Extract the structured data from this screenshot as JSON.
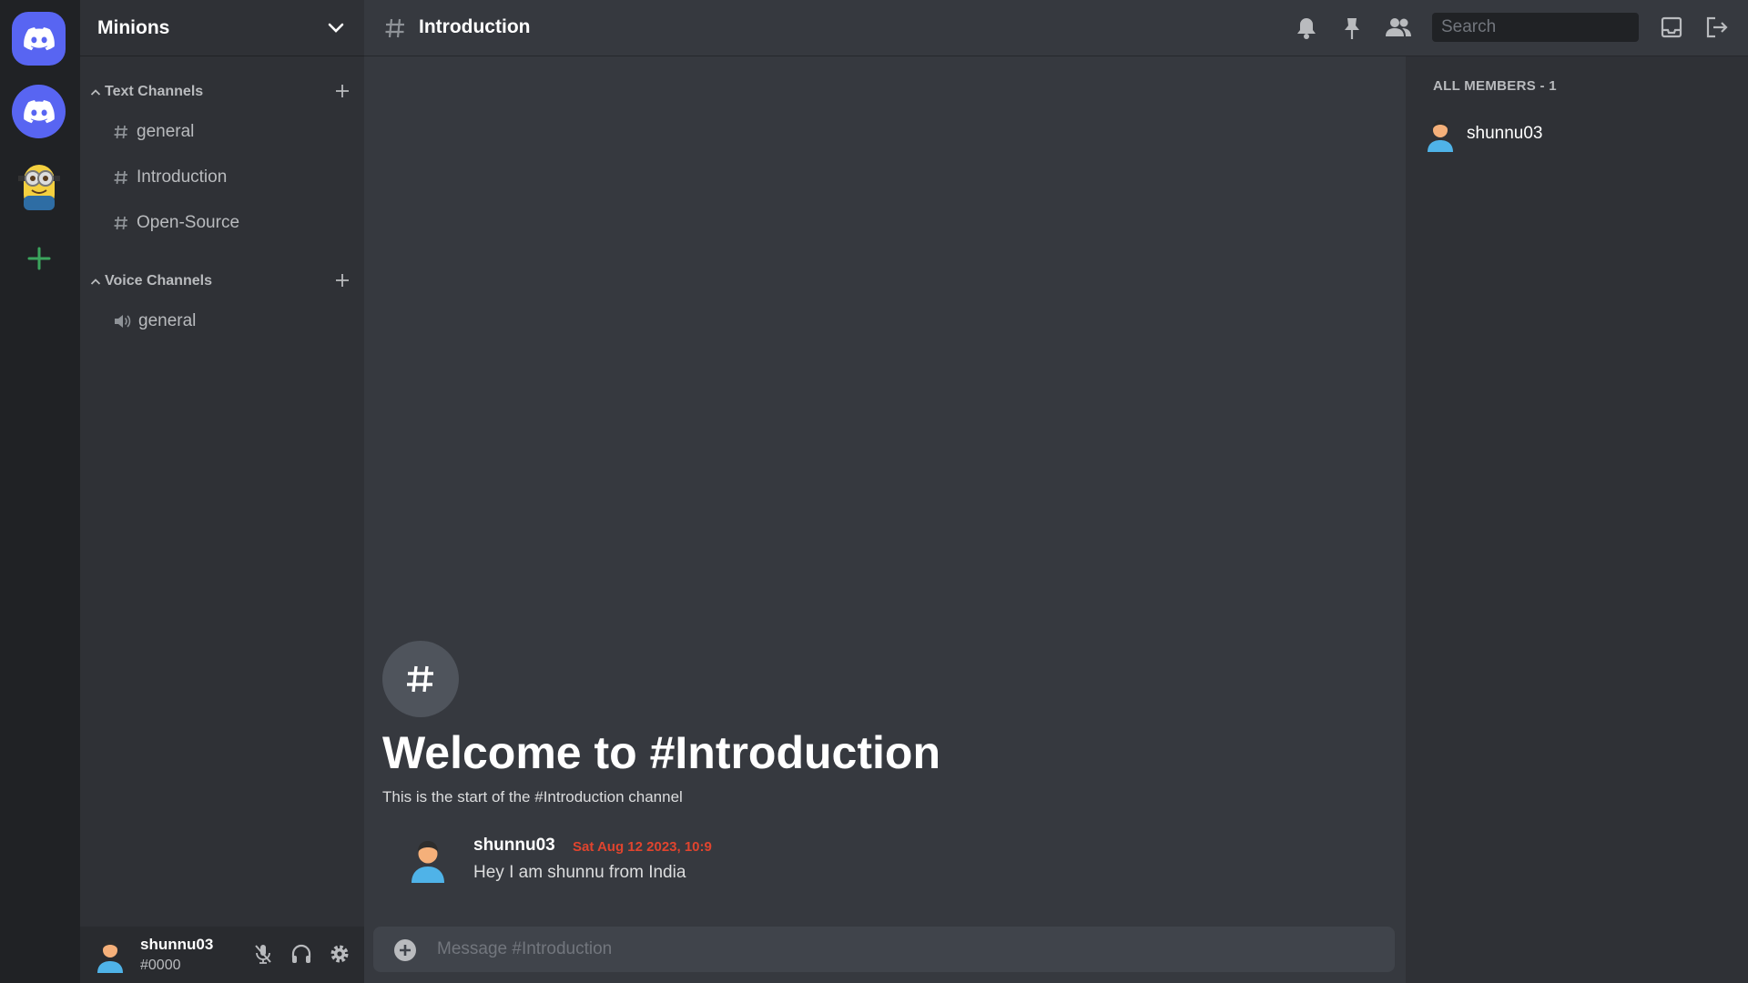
{
  "servers": [
    {
      "name": "Discord Home",
      "icon": "discord-logo-icon"
    },
    {
      "name": "Discord",
      "icon": "discord-logo-icon"
    },
    {
      "name": "Minions",
      "icon": "minion-avatar-icon"
    }
  ],
  "add_server_icon": "plus-icon",
  "server": {
    "name": "Minions"
  },
  "categories": {
    "text": {
      "label": "Text Channels",
      "channels": [
        {
          "name": "general"
        },
        {
          "name": "Introduction"
        },
        {
          "name": "Open-Source"
        }
      ]
    },
    "voice": {
      "label": "Voice Channels",
      "channels": [
        {
          "name": "general"
        }
      ]
    }
  },
  "user": {
    "name": "shunnu03",
    "tag": "#0000"
  },
  "header": {
    "channel": "Introduction",
    "search_placeholder": "Search"
  },
  "welcome": {
    "title": "Welcome to #Introduction",
    "subtitle": "This is the start of the #Introduction channel"
  },
  "messages": [
    {
      "author": "shunnu03",
      "timestamp": "Sat Aug 12 2023, 10:9",
      "text": "Hey I am shunnu from India"
    }
  ],
  "composer": {
    "placeholder": "Message #Introduction"
  },
  "members": {
    "header": "ALL MEMBERS - 1",
    "list": [
      {
        "name": "shunnu03"
      }
    ]
  },
  "colors": {
    "accent": "#5865f2",
    "add_server": "#3ba55d",
    "timestamp": "#e0442e"
  }
}
